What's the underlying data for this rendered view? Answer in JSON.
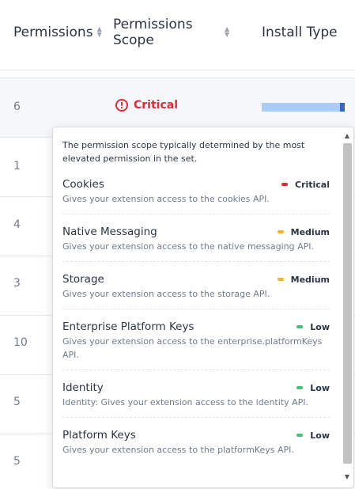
{
  "header": {
    "permissions_label": "Permissions",
    "scope_label": "Permissions Scope",
    "install_type_label": "Install Type",
    "sort_up": "▲",
    "sort_down": "▼"
  },
  "rows": [
    {
      "count": "6",
      "scope": "Critical"
    },
    {
      "count": "1"
    },
    {
      "count": "4"
    },
    {
      "count": "3"
    },
    {
      "count": "10"
    },
    {
      "count": "5"
    },
    {
      "count": "5"
    }
  ],
  "popup": {
    "intro": "The permission scope typically determined by the most elevated permission in the set.",
    "permissions": [
      {
        "name": "Cookies",
        "level": "Critical",
        "description": "Gives your extension access to the cookies API."
      },
      {
        "name": "Native Messaging",
        "level": "Medium",
        "description": "Gives your extension access to the native messaging API."
      },
      {
        "name": "Storage",
        "level": "Medium",
        "description": "Gives your extension access to the storage API."
      },
      {
        "name": "Enterprise Platform Keys",
        "level": "Low",
        "description": "Gives your extension access to the enterprise.platformKeys API."
      },
      {
        "name": "Identity",
        "level": "Low",
        "description": "Identity: Gives your extension access to the identity API."
      },
      {
        "name": "Platform Keys",
        "level": "Low",
        "description": "Gives your extension access to the platformKeys API."
      }
    ]
  },
  "colors": {
    "critical": "#e02b35",
    "medium": "#f5b523",
    "low": "#3cc27a",
    "install_bar": "#a9cdf8",
    "install_bar_cap": "#3a66c4"
  }
}
